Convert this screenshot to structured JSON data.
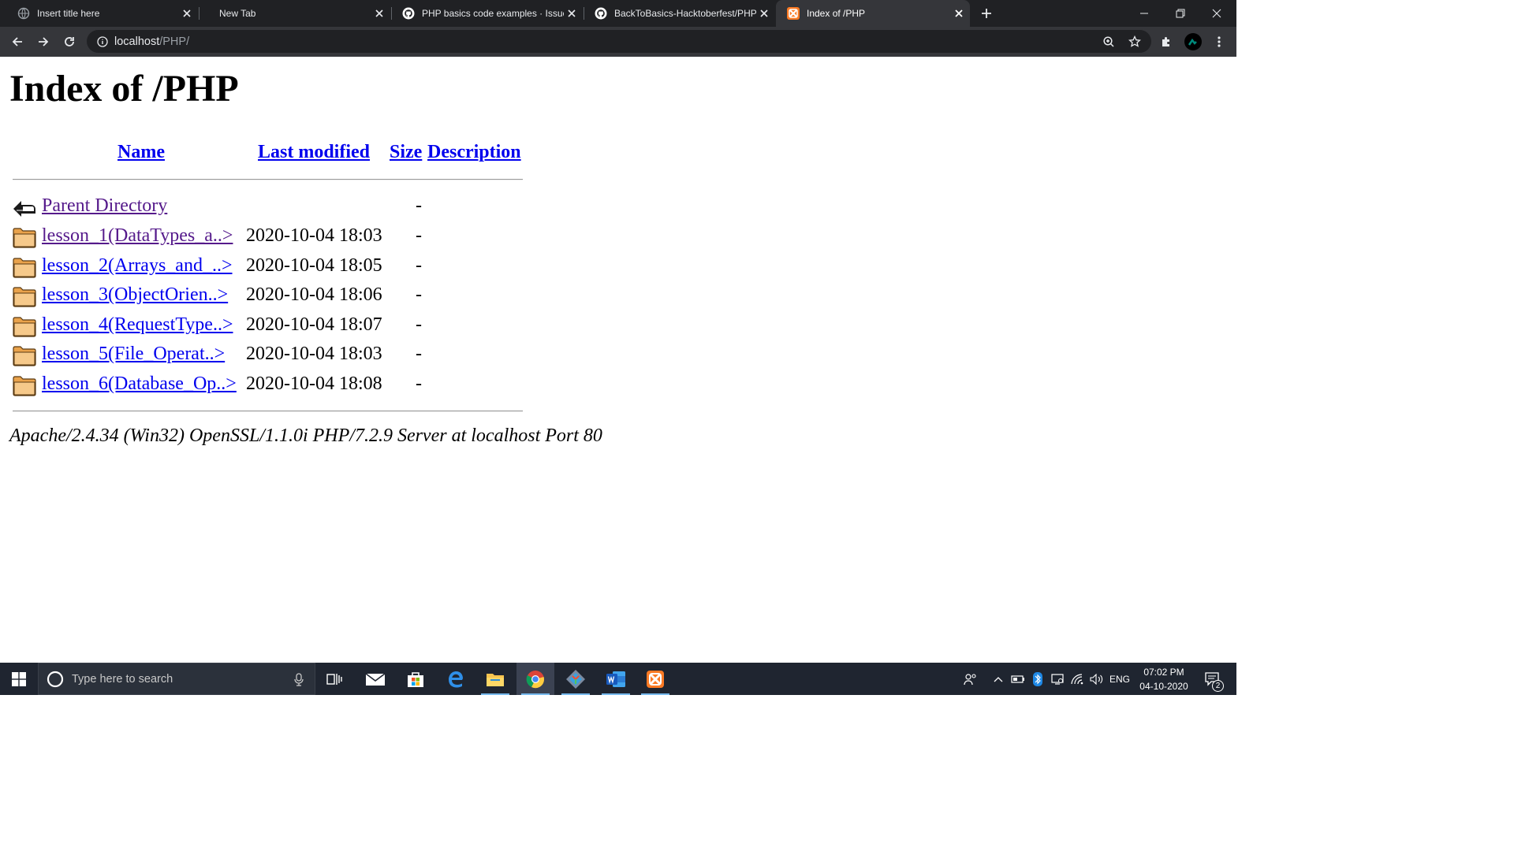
{
  "browser": {
    "tabs": [
      {
        "title": "Insert title here",
        "icon": "globe-icon",
        "active": false
      },
      {
        "title": "New Tab",
        "icon": "",
        "active": false
      },
      {
        "title": "PHP basics code examples · Issue",
        "icon": "github-icon",
        "active": false
      },
      {
        "title": "BackToBasics-Hacktoberfest/PHP",
        "icon": "github-icon",
        "active": false
      },
      {
        "title": "Index of /PHP",
        "icon": "xampp-icon",
        "active": true
      }
    ],
    "url_host": "localhost",
    "url_path": "/PHP/",
    "accent": "#00897b"
  },
  "page": {
    "heading": "Index of /PHP",
    "columns": {
      "name": "Name",
      "last_modified": "Last modified",
      "size": "Size",
      "description": "Description"
    },
    "parent": {
      "name": "Parent Directory",
      "size": "-"
    },
    "entries": [
      {
        "name": "lesson_1(DataTypes_a..>",
        "modified": "2020-10-04 18:03",
        "size": "-"
      },
      {
        "name": "lesson_2(Arrays_and_..>",
        "modified": "2020-10-04 18:05",
        "size": "-"
      },
      {
        "name": "lesson_3(ObjectOrien..>",
        "modified": "2020-10-04 18:06",
        "size": "-"
      },
      {
        "name": "lesson_4(RequestType..>",
        "modified": "2020-10-04 18:07",
        "size": "-"
      },
      {
        "name": "lesson_5(File_Operat..>",
        "modified": "2020-10-04 18:03",
        "size": "-"
      },
      {
        "name": "lesson_6(Database_Op..>",
        "modified": "2020-10-04 18:08",
        "size": "-"
      }
    ],
    "address": "Apache/2.4.34 (Win32) OpenSSL/1.1.0i PHP/7.2.9 Server at localhost Port 80"
  },
  "taskbar": {
    "search_placeholder": "Type here to search",
    "apps": [
      "task-view-icon",
      "mail-icon",
      "store-icon",
      "edge-icon",
      "file-explorer-icon",
      "chrome-icon",
      "git-icon",
      "word-icon",
      "xampp-icon"
    ],
    "language": "ENG",
    "time": "07:02 PM",
    "date": "04-10-2020",
    "notification_count": "2"
  }
}
